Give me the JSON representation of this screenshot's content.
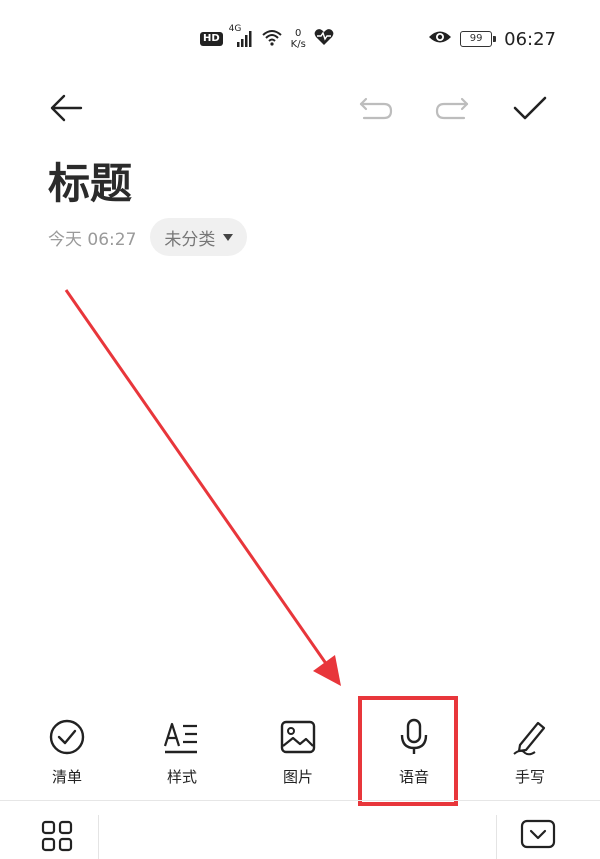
{
  "status_bar": {
    "hd": "HD",
    "network": "4G",
    "speed_value": "0",
    "speed_unit": "K/s",
    "battery": "99",
    "time": "06:27"
  },
  "note": {
    "title": "标题",
    "date": "今天 06:27",
    "category": "未分类"
  },
  "toolbar": {
    "items": [
      {
        "label": "清单"
      },
      {
        "label": "样式"
      },
      {
        "label": "图片"
      },
      {
        "label": "语音"
      },
      {
        "label": "手写"
      }
    ]
  },
  "colors": {
    "highlight": "#e8363b",
    "text": "#2b2b2b",
    "muted": "#9a9a9a"
  }
}
